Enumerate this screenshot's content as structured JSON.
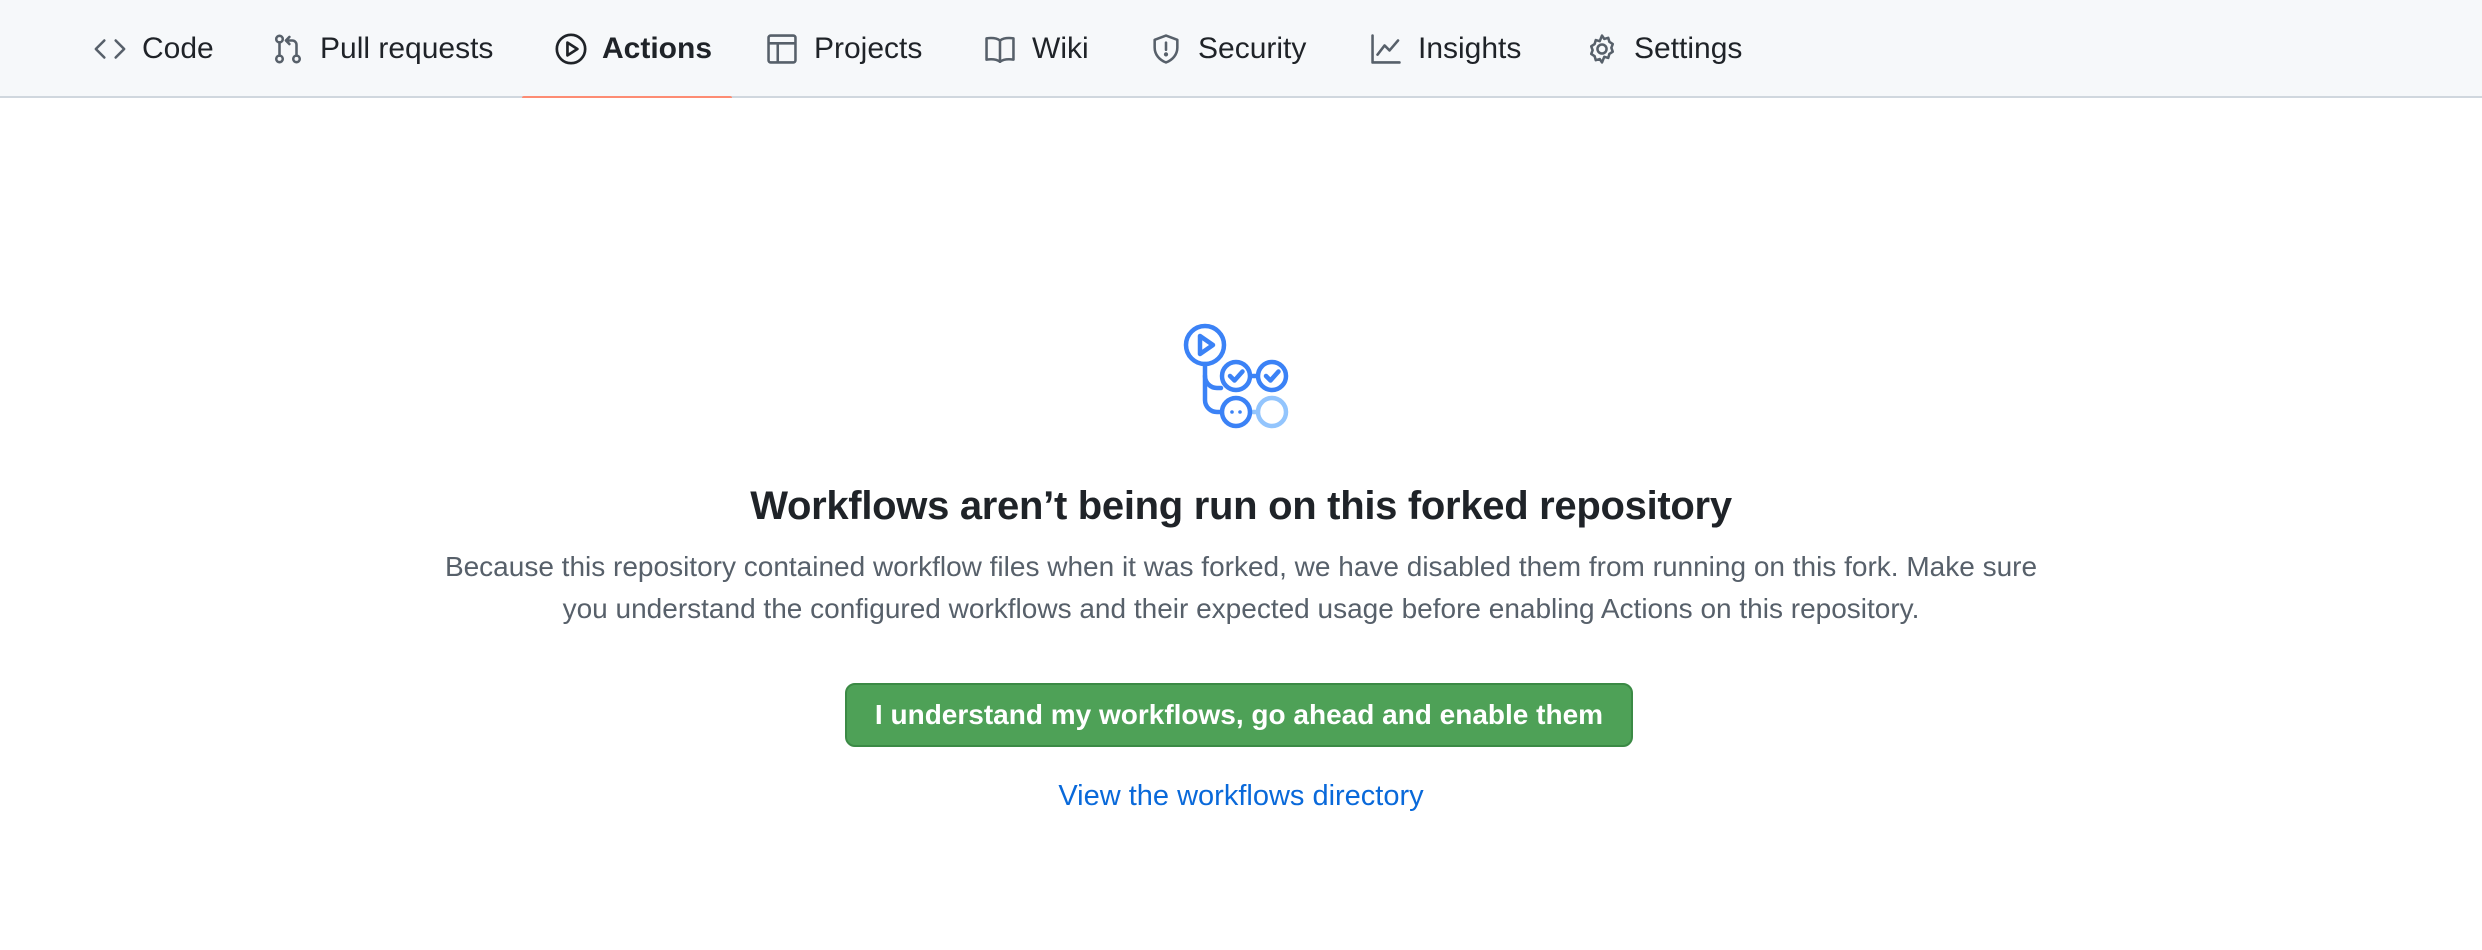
{
  "nav": {
    "tabs": [
      {
        "label": "Code",
        "icon": "code-icon",
        "selected": false
      },
      {
        "label": "Pull requests",
        "icon": "pull-request-icon",
        "selected": false
      },
      {
        "label": "Actions",
        "icon": "play-circle-icon",
        "selected": true
      },
      {
        "label": "Projects",
        "icon": "table-icon",
        "selected": false
      },
      {
        "label": "Wiki",
        "icon": "book-icon",
        "selected": false
      },
      {
        "label": "Security",
        "icon": "shield-icon",
        "selected": false
      },
      {
        "label": "Insights",
        "icon": "graph-icon",
        "selected": false
      },
      {
        "label": "Settings",
        "icon": "gear-icon",
        "selected": false
      }
    ]
  },
  "main": {
    "icon": "workflow-icon",
    "title": "Workflows aren’t being run on this forked repository",
    "description": "Because this repository contained workflow files when it was forked, we have disabled them from running on this fork. Make sure you understand the configured workflows and their expected usage before enabling Actions on this repository.",
    "enable_button_label": "I understand my workflows, go ahead and enable them",
    "workflows_link_label": "View the workflows directory"
  },
  "colors": {
    "accent_underline": "#fd8c73",
    "button_green": "#4ea157",
    "link_blue": "#0969da",
    "icon_blue": "#3b82f6"
  }
}
